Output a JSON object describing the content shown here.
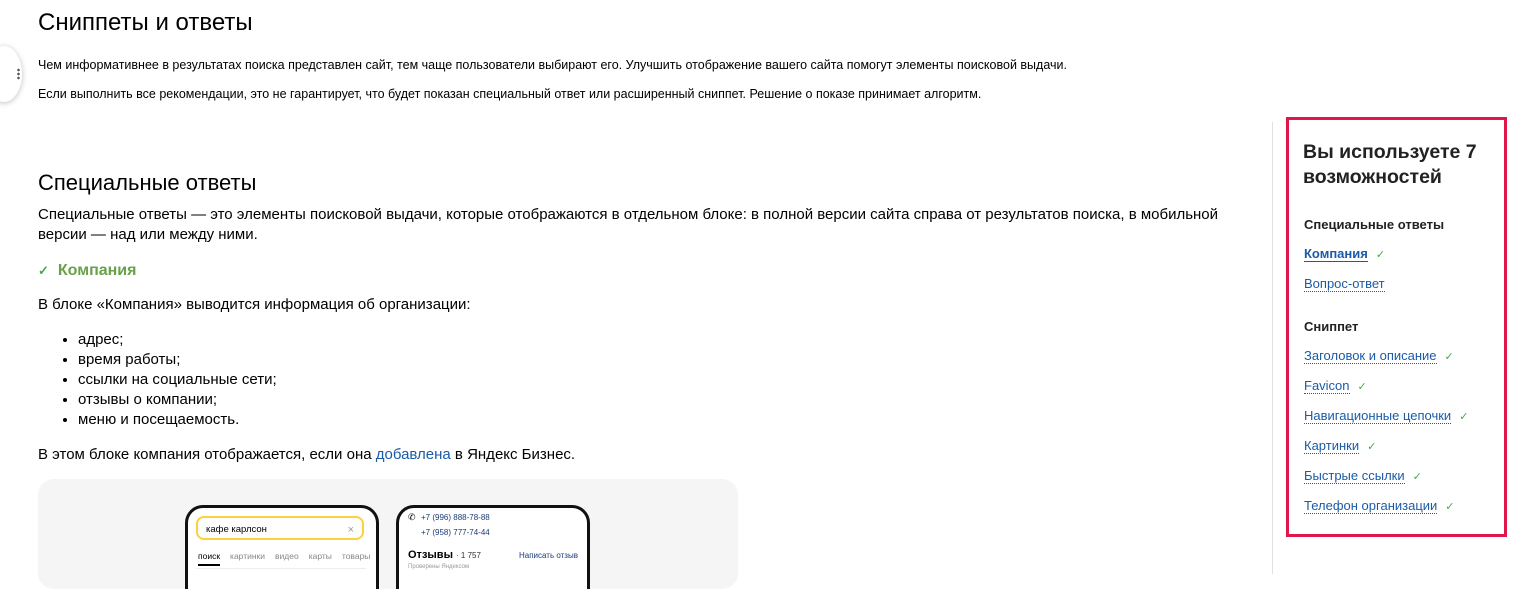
{
  "page": {
    "title": "Сниппеты и ответы",
    "intro": [
      "Чем информативнее в результатах поиска представлен сайт, тем чаще пользователи выбирают его. Улучшить отображение вашего сайта помогут элементы поисковой выдачи.",
      "Если выполнить все рекомендации, это не гарантирует, что будет показан специальный ответ или расширенный сниппет. Решение о показе принимает алгоритм."
    ]
  },
  "special": {
    "heading": "Специальные ответы",
    "description": "Специальные ответы — это элементы поисковой выдачи, которые отображаются в отдельном блоке: в полной версии сайта справа от результатов поиска, в мобильной версии — над или между ними."
  },
  "company": {
    "title": "Компания",
    "lead": "В блоке «Компания» выводится информация об организации:",
    "items": [
      "адрес;",
      "время работы;",
      "ссылки на социальные сети;",
      "отзывы о компании;",
      "меню и посещаемость."
    ],
    "note_before": "В этом блоке компания отображается, если она ",
    "note_link": "добавлена",
    "note_after": " в Яндекс Бизнес."
  },
  "preview": {
    "search_query": "кафе карлсон",
    "clear_icon": "×",
    "tabs": [
      "поиск",
      "картинки",
      "видео",
      "карты",
      "товары"
    ],
    "phone_numbers": [
      "+7 (996) 888-78-88",
      "+7 (958) 777-74-44"
    ],
    "reviews_title": "Отзывы",
    "reviews_count": "· 1 757",
    "reviews_sub": "Проверены Яндексом",
    "write_review": "Написать отзыв"
  },
  "sidebar": {
    "title": "Вы используете 7 возможностей",
    "sections": [
      {
        "label": "Специальные ответы",
        "items": [
          {
            "label": "Компания",
            "checked": true,
            "current": true
          },
          {
            "label": "Вопрос-ответ",
            "checked": false
          }
        ]
      },
      {
        "label": "Сниппет",
        "items": [
          {
            "label": "Заголовок и описание",
            "checked": true
          },
          {
            "label": "Favicon",
            "checked": true
          },
          {
            "label": "Навигационные цепочки",
            "checked": true
          },
          {
            "label": "Картинки",
            "checked": true
          },
          {
            "label": "Быстрые ссылки",
            "checked": true
          },
          {
            "label": "Телефон организации",
            "checked": true
          }
        ]
      }
    ],
    "check_icon": "✓"
  },
  "colors": {
    "accent_border": "#e0164b",
    "link": "#1a5ba8",
    "check": "#3dae4a",
    "company_title": "#6aa04a"
  }
}
